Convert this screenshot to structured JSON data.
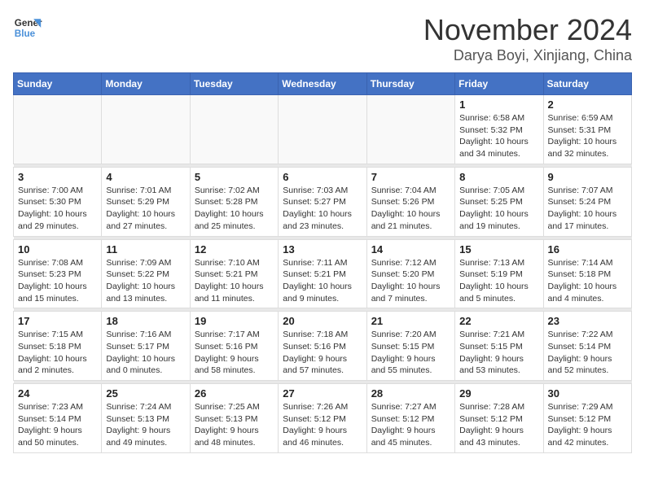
{
  "logo": {
    "line1": "General",
    "line2": "Blue"
  },
  "title": "November 2024",
  "location": "Darya Boyi, Xinjiang, China",
  "weekdays": [
    "Sunday",
    "Monday",
    "Tuesday",
    "Wednesday",
    "Thursday",
    "Friday",
    "Saturday"
  ],
  "weeks": [
    [
      {
        "day": "",
        "detail": ""
      },
      {
        "day": "",
        "detail": ""
      },
      {
        "day": "",
        "detail": ""
      },
      {
        "day": "",
        "detail": ""
      },
      {
        "day": "",
        "detail": ""
      },
      {
        "day": "1",
        "detail": "Sunrise: 6:58 AM\nSunset: 5:32 PM\nDaylight: 10 hours and 34 minutes."
      },
      {
        "day": "2",
        "detail": "Sunrise: 6:59 AM\nSunset: 5:31 PM\nDaylight: 10 hours and 32 minutes."
      }
    ],
    [
      {
        "day": "3",
        "detail": "Sunrise: 7:00 AM\nSunset: 5:30 PM\nDaylight: 10 hours and 29 minutes."
      },
      {
        "day": "4",
        "detail": "Sunrise: 7:01 AM\nSunset: 5:29 PM\nDaylight: 10 hours and 27 minutes."
      },
      {
        "day": "5",
        "detail": "Sunrise: 7:02 AM\nSunset: 5:28 PM\nDaylight: 10 hours and 25 minutes."
      },
      {
        "day": "6",
        "detail": "Sunrise: 7:03 AM\nSunset: 5:27 PM\nDaylight: 10 hours and 23 minutes."
      },
      {
        "day": "7",
        "detail": "Sunrise: 7:04 AM\nSunset: 5:26 PM\nDaylight: 10 hours and 21 minutes."
      },
      {
        "day": "8",
        "detail": "Sunrise: 7:05 AM\nSunset: 5:25 PM\nDaylight: 10 hours and 19 minutes."
      },
      {
        "day": "9",
        "detail": "Sunrise: 7:07 AM\nSunset: 5:24 PM\nDaylight: 10 hours and 17 minutes."
      }
    ],
    [
      {
        "day": "10",
        "detail": "Sunrise: 7:08 AM\nSunset: 5:23 PM\nDaylight: 10 hours and 15 minutes."
      },
      {
        "day": "11",
        "detail": "Sunrise: 7:09 AM\nSunset: 5:22 PM\nDaylight: 10 hours and 13 minutes."
      },
      {
        "day": "12",
        "detail": "Sunrise: 7:10 AM\nSunset: 5:21 PM\nDaylight: 10 hours and 11 minutes."
      },
      {
        "day": "13",
        "detail": "Sunrise: 7:11 AM\nSunset: 5:21 PM\nDaylight: 10 hours and 9 minutes."
      },
      {
        "day": "14",
        "detail": "Sunrise: 7:12 AM\nSunset: 5:20 PM\nDaylight: 10 hours and 7 minutes."
      },
      {
        "day": "15",
        "detail": "Sunrise: 7:13 AM\nSunset: 5:19 PM\nDaylight: 10 hours and 5 minutes."
      },
      {
        "day": "16",
        "detail": "Sunrise: 7:14 AM\nSunset: 5:18 PM\nDaylight: 10 hours and 4 minutes."
      }
    ],
    [
      {
        "day": "17",
        "detail": "Sunrise: 7:15 AM\nSunset: 5:18 PM\nDaylight: 10 hours and 2 minutes."
      },
      {
        "day": "18",
        "detail": "Sunrise: 7:16 AM\nSunset: 5:17 PM\nDaylight: 10 hours and 0 minutes."
      },
      {
        "day": "19",
        "detail": "Sunrise: 7:17 AM\nSunset: 5:16 PM\nDaylight: 9 hours and 58 minutes."
      },
      {
        "day": "20",
        "detail": "Sunrise: 7:18 AM\nSunset: 5:16 PM\nDaylight: 9 hours and 57 minutes."
      },
      {
        "day": "21",
        "detail": "Sunrise: 7:20 AM\nSunset: 5:15 PM\nDaylight: 9 hours and 55 minutes."
      },
      {
        "day": "22",
        "detail": "Sunrise: 7:21 AM\nSunset: 5:15 PM\nDaylight: 9 hours and 53 minutes."
      },
      {
        "day": "23",
        "detail": "Sunrise: 7:22 AM\nSunset: 5:14 PM\nDaylight: 9 hours and 52 minutes."
      }
    ],
    [
      {
        "day": "24",
        "detail": "Sunrise: 7:23 AM\nSunset: 5:14 PM\nDaylight: 9 hours and 50 minutes."
      },
      {
        "day": "25",
        "detail": "Sunrise: 7:24 AM\nSunset: 5:13 PM\nDaylight: 9 hours and 49 minutes."
      },
      {
        "day": "26",
        "detail": "Sunrise: 7:25 AM\nSunset: 5:13 PM\nDaylight: 9 hours and 48 minutes."
      },
      {
        "day": "27",
        "detail": "Sunrise: 7:26 AM\nSunset: 5:12 PM\nDaylight: 9 hours and 46 minutes."
      },
      {
        "day": "28",
        "detail": "Sunrise: 7:27 AM\nSunset: 5:12 PM\nDaylight: 9 hours and 45 minutes."
      },
      {
        "day": "29",
        "detail": "Sunrise: 7:28 AM\nSunset: 5:12 PM\nDaylight: 9 hours and 43 minutes."
      },
      {
        "day": "30",
        "detail": "Sunrise: 7:29 AM\nSunset: 5:12 PM\nDaylight: 9 hours and 42 minutes."
      }
    ]
  ]
}
